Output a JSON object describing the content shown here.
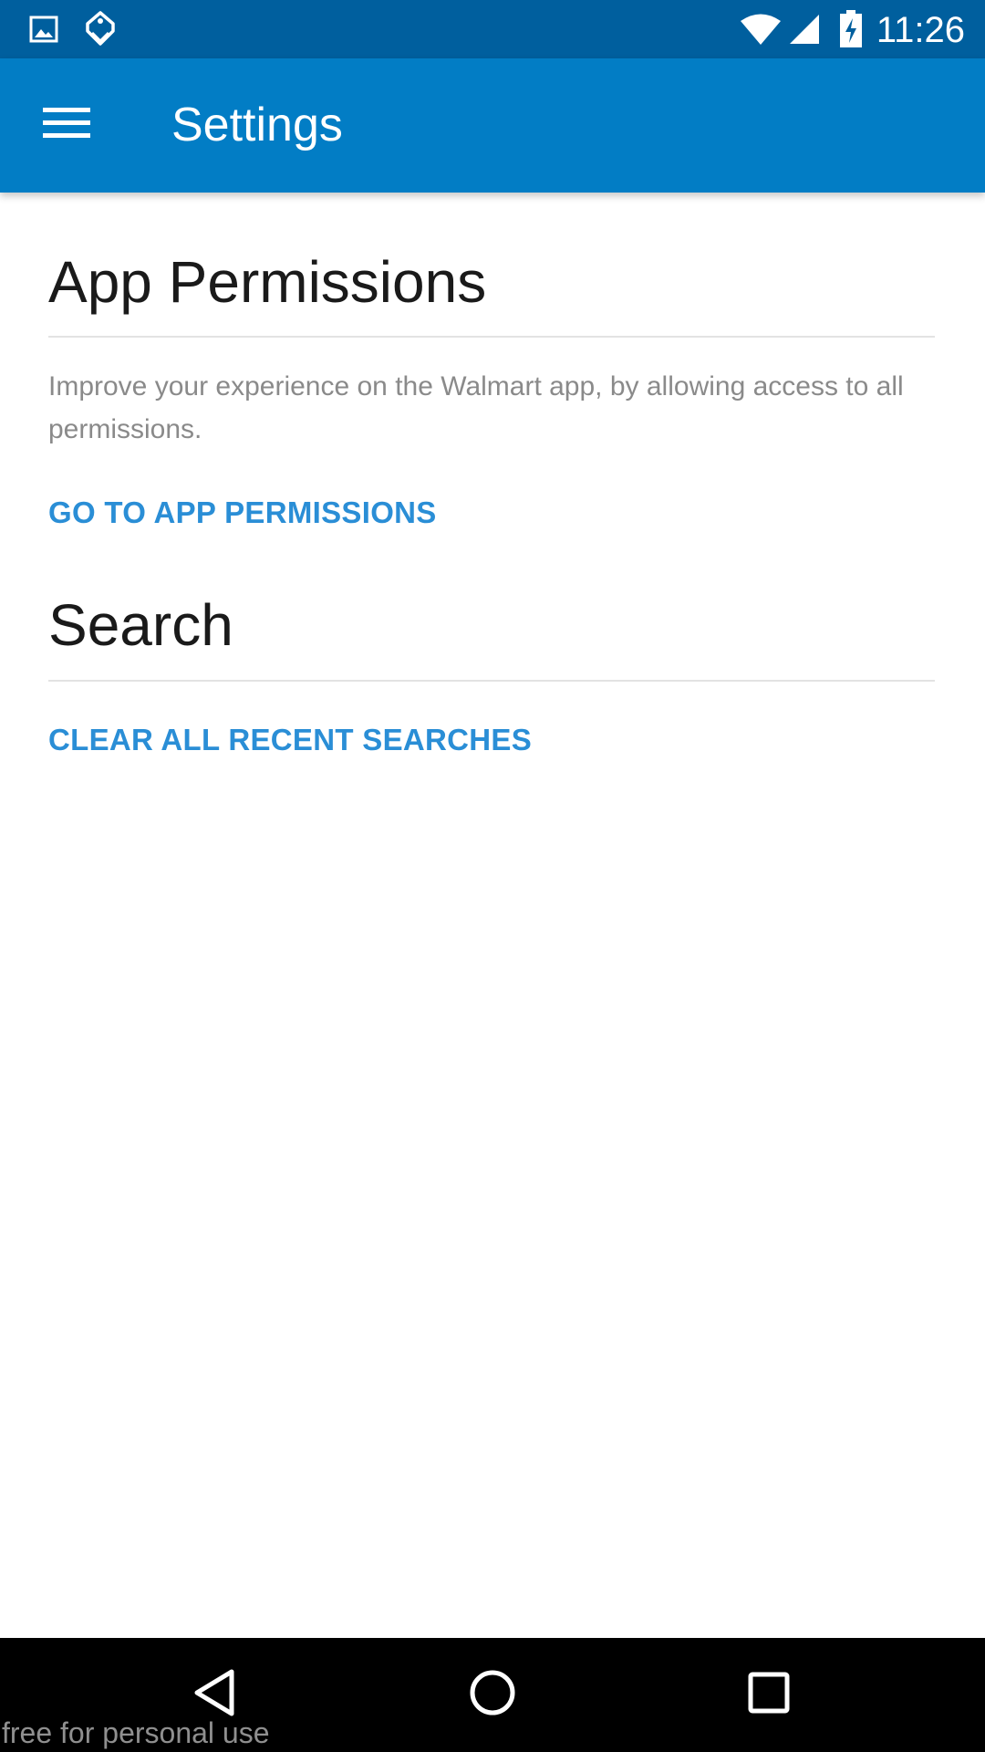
{
  "status_bar": {
    "time": "11:26",
    "icons": [
      "image-icon",
      "tag-icon",
      "wifi-icon",
      "signal-icon",
      "battery-charging-icon"
    ]
  },
  "app_bar": {
    "menu_icon": "hamburger-menu-icon",
    "title": "Settings"
  },
  "sections": {
    "permissions": {
      "heading": "App Permissions",
      "description": "Improve your experience on the Walmart app, by allowing access to all permissions.",
      "link": "GO TO APP PERMISSIONS"
    },
    "search": {
      "heading": "Search",
      "link": "CLEAR ALL RECENT SEARCHES"
    }
  },
  "nav_bar": {
    "icons": [
      "back-icon",
      "home-icon",
      "recents-icon"
    ]
  },
  "watermark": "free for personal use",
  "colors": {
    "status_bar": "#005f9e",
    "app_bar": "#027dc5",
    "link": "#2a8ed6",
    "heading": "#1a1a1a",
    "description": "#8a8a8a"
  }
}
